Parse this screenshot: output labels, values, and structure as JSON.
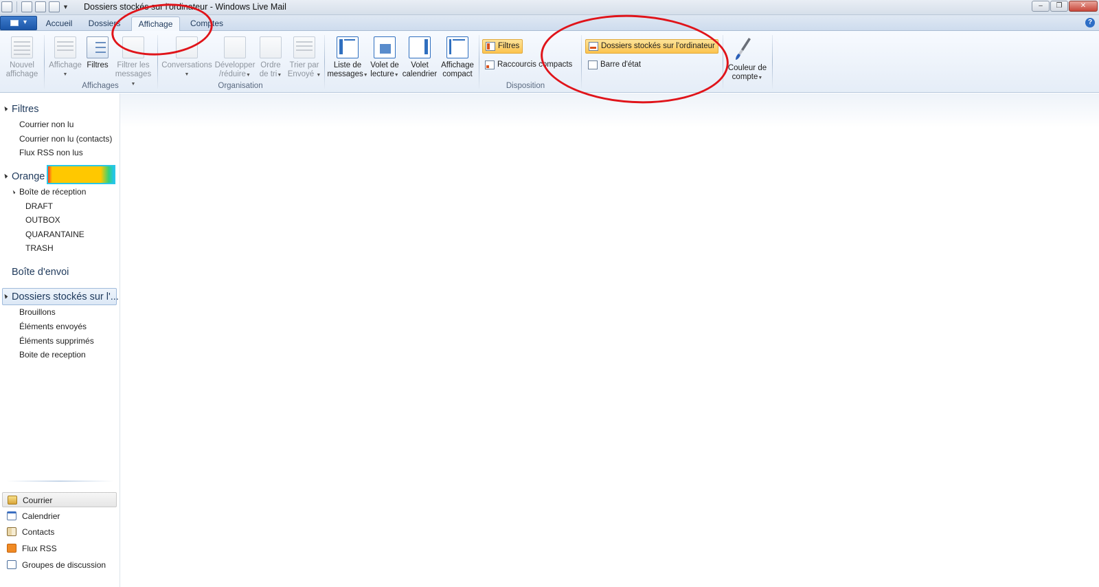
{
  "window": {
    "title": "Dossiers stockés sur l'ordinateur - Windows Live Mail",
    "controls": [
      "minimize",
      "restore",
      "close"
    ]
  },
  "tabs": [
    {
      "label": "Accueil",
      "active": false
    },
    {
      "label": "Dossiers",
      "active": false
    },
    {
      "label": "Affichage",
      "active": true
    },
    {
      "label": "Comptes",
      "active": false
    }
  ],
  "ribbon": {
    "nouvel_affichage": {
      "line1": "Nouvel",
      "line2": "affichage"
    },
    "affichage": {
      "line1": "Affichage"
    },
    "filtres": {
      "line1": "Filtres"
    },
    "filtrer_messages": {
      "line1": "Filtrer les",
      "line2": "messages"
    },
    "conversations": {
      "line1": "Conversations"
    },
    "developper": {
      "line1": "Développer",
      "line2": "/réduire"
    },
    "ordre_tri": {
      "line1": "Ordre",
      "line2": "de tri"
    },
    "trier_par": {
      "line1": "Trier par",
      "line2": "Envoyé"
    },
    "liste_messages": {
      "line1": "Liste de",
      "line2": "messages"
    },
    "volet_lecture": {
      "line1": "Volet de",
      "line2": "lecture"
    },
    "volet_calendrier": {
      "line1": "Volet",
      "line2": "calendrier"
    },
    "affichage_compact": {
      "line1": "Affichage",
      "line2": "compact"
    },
    "filtres_toggle": "Filtres",
    "raccourcis_compacts": "Raccourcis compacts",
    "dossiers_stockes": "Dossiers stockés sur l'ordinateur",
    "barre_etat": "Barre d'état",
    "couleur_compte": {
      "line1": "Couleur de",
      "line2": "compte"
    },
    "groups": {
      "affichages": "Affichages",
      "organisation": "Organisation",
      "disposition": "Disposition"
    }
  },
  "nav": {
    "filtres_header": "Filtres",
    "filtres_items": [
      "Courrier non lu",
      "Courrier non lu (contacts)",
      "Flux RSS non lus"
    ],
    "orange_header": "Orange",
    "inbox": "Boîte de réception",
    "orange_subfolders": [
      "DRAFT",
      "OUTBOX",
      "QUARANTAINE",
      "TRASH"
    ],
    "outbox_header": "Boîte d'envoi",
    "storage_header": "Dossiers stockés sur l'...",
    "storage_items": [
      "Brouillons",
      "Éléments envoyés",
      "Éléments supprimés",
      "Boite de reception"
    ]
  },
  "modules": [
    "Courrier",
    "Calendrier",
    "Contacts",
    "Flux RSS",
    "Groupes de discussion"
  ],
  "colors": {
    "accent_blue": "#1e395b",
    "active_toggle": "#fcc34e",
    "annotation_red": "#e0141a"
  }
}
